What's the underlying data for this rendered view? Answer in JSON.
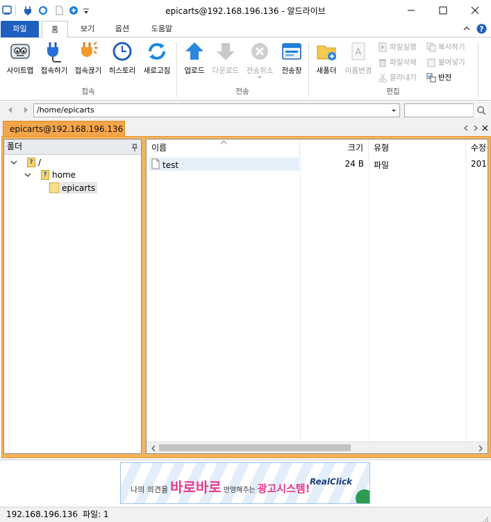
{
  "window": {
    "title": "epicarts@192.168.196.136 - 알드라이브"
  },
  "ribbon_tabs": [
    "파일",
    "홈",
    "보기",
    "옵션",
    "도움말"
  ],
  "ribbon": {
    "connect_group": {
      "label": "접속",
      "buttons": [
        "사이트맵",
        "접속하기",
        "접속끊기",
        "히스토리",
        "새로고침"
      ]
    },
    "transfer_group": {
      "label": "전송",
      "buttons": [
        "업로드",
        "다운로드",
        "전송취소",
        "전송창"
      ]
    },
    "edit_group": {
      "label": "편집",
      "buttons": [
        "새폴더",
        "이름변경"
      ],
      "small_buttons": [
        "파일실행",
        "파일삭제",
        "잘라내기",
        "복사하기",
        "붙여넣기",
        "반전"
      ]
    }
  },
  "address": {
    "path": "/home/epicarts"
  },
  "connection_tab": "epicarts@192.168.196.136",
  "folder_panel": {
    "title": "폴더",
    "pin": "ᅟ",
    "tree": [
      "/",
      "home",
      "epicarts"
    ]
  },
  "file_list": {
    "columns": [
      "이름",
      "크기",
      "유형",
      "수정"
    ],
    "rows": [
      {
        "name": "test",
        "size": "24 B",
        "type": "파일",
        "modified": "201"
      }
    ]
  },
  "ad": {
    "text_1": "나의 의견을",
    "text_2": "바로바로",
    "text_3": "반영해주는",
    "text_4": "광고시스템!",
    "brand": "RealClick"
  },
  "statusbar": {
    "host": "192.168.196.136",
    "files": "파일: 1"
  },
  "colors": {
    "accent_blue": "#1f5fbf",
    "orange_frame": "#f5b35a",
    "ad_pink": "#e8388b"
  }
}
